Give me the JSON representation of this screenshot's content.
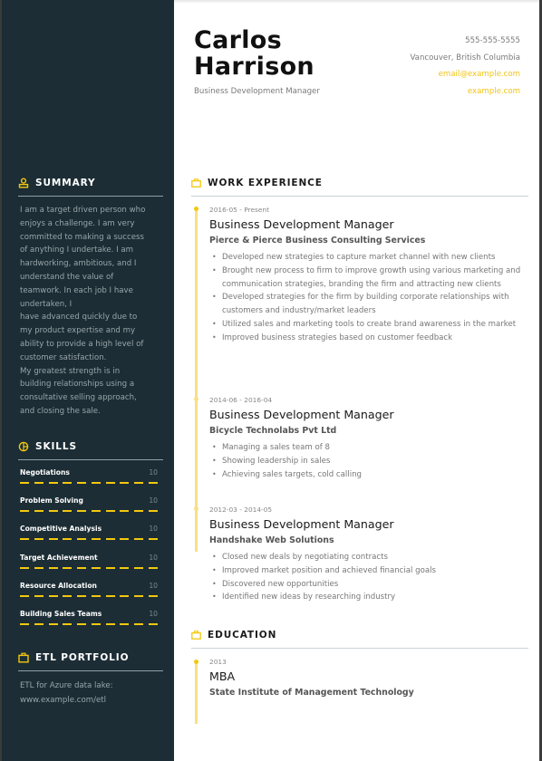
{
  "header": {
    "name_line1": "Carlos",
    "name_line2": "Harrison",
    "role": "Business Development Manager",
    "phone": "555-555-5555",
    "location": "Vancouver, British Columbia",
    "email": "email@example.com",
    "website": "example.com"
  },
  "colors": {
    "sidebar_bg": "#1c2d35",
    "accent": "#f2c80f",
    "timeline": "#f7e087"
  },
  "sidebar": {
    "summary": {
      "icon": "person-icon",
      "title": "SUMMARY",
      "lines": [
        "I am a target driven person who",
        "enjoys a challenge. I am very",
        "committed to making a success",
        "of anything I undertake. I am",
        "hardworking, ambitious, and I",
        "understand the value of",
        "teamwork. In each job I have",
        "undertaken, I",
        "have advanced quickly due to",
        "my product expertise and my",
        "ability to provide a high level of",
        "customer satisfaction.",
        "My greatest strength is in",
        "building relationships using a",
        "consultative selling approach,",
        "and closing the sale."
      ]
    },
    "skills": {
      "icon": "pie-chart-icon",
      "title": "SKILLS",
      "max": 10,
      "items": [
        {
          "name": "Negotiations",
          "level": 10
        },
        {
          "name": "Problem Solving",
          "level": 10
        },
        {
          "name": "Competitive Analysis",
          "level": 10
        },
        {
          "name": "Target Achievement",
          "level": 10
        },
        {
          "name": "Resource Allocation",
          "level": 10
        },
        {
          "name": "Building Sales Teams",
          "level": 10
        }
      ]
    },
    "portfolio": {
      "icon": "briefcase-icon",
      "title": "ETL PORTFOLIO",
      "line1": "ETL for Azure data lake:",
      "line2": "www.example.com/etl"
    }
  },
  "work": {
    "icon": "briefcase-icon",
    "title": "WORK EXPERIENCE",
    "jobs": [
      {
        "date": "2016-05 - Present",
        "title": "Business Development Manager",
        "org": "Pierce & Pierce Business Consulting Services",
        "bullets": [
          "Developed new strategies to capture market channel with new clients",
          "Brought new process to firm to improve growth using various marketing and communication strategies, branding the firm and attracting new clients",
          "Developed strategies for the firm by building corporate relationships with customers and industry/market leaders",
          "Utilized sales and marketing tools to create brand awareness in the market",
          "Improved business strategies based on customer feedback"
        ]
      },
      {
        "date": "2014-06 - 2016-04",
        "title": "Business Development Manager",
        "org": "Bicycle Technolabs Pvt Ltd",
        "bullets": [
          "Managing a sales team of 8",
          "Showing leadership in sales",
          "Achieving sales targets, cold calling"
        ]
      },
      {
        "date": "2012-03 - 2014-05",
        "title": "Business Development Manager",
        "org": "Handshake Web Solutions",
        "bullets": [
          "Closed new deals by negotiating contracts",
          "Improved market position and achieved financial goals",
          "Discovered new opportunities",
          "Identified new ideas by researching industry"
        ]
      }
    ]
  },
  "education": {
    "icon": "briefcase-icon",
    "title": "EDUCATION",
    "items": [
      {
        "date": "2013",
        "degree": "MBA",
        "school": "State Institute of Management Technology"
      }
    ]
  }
}
